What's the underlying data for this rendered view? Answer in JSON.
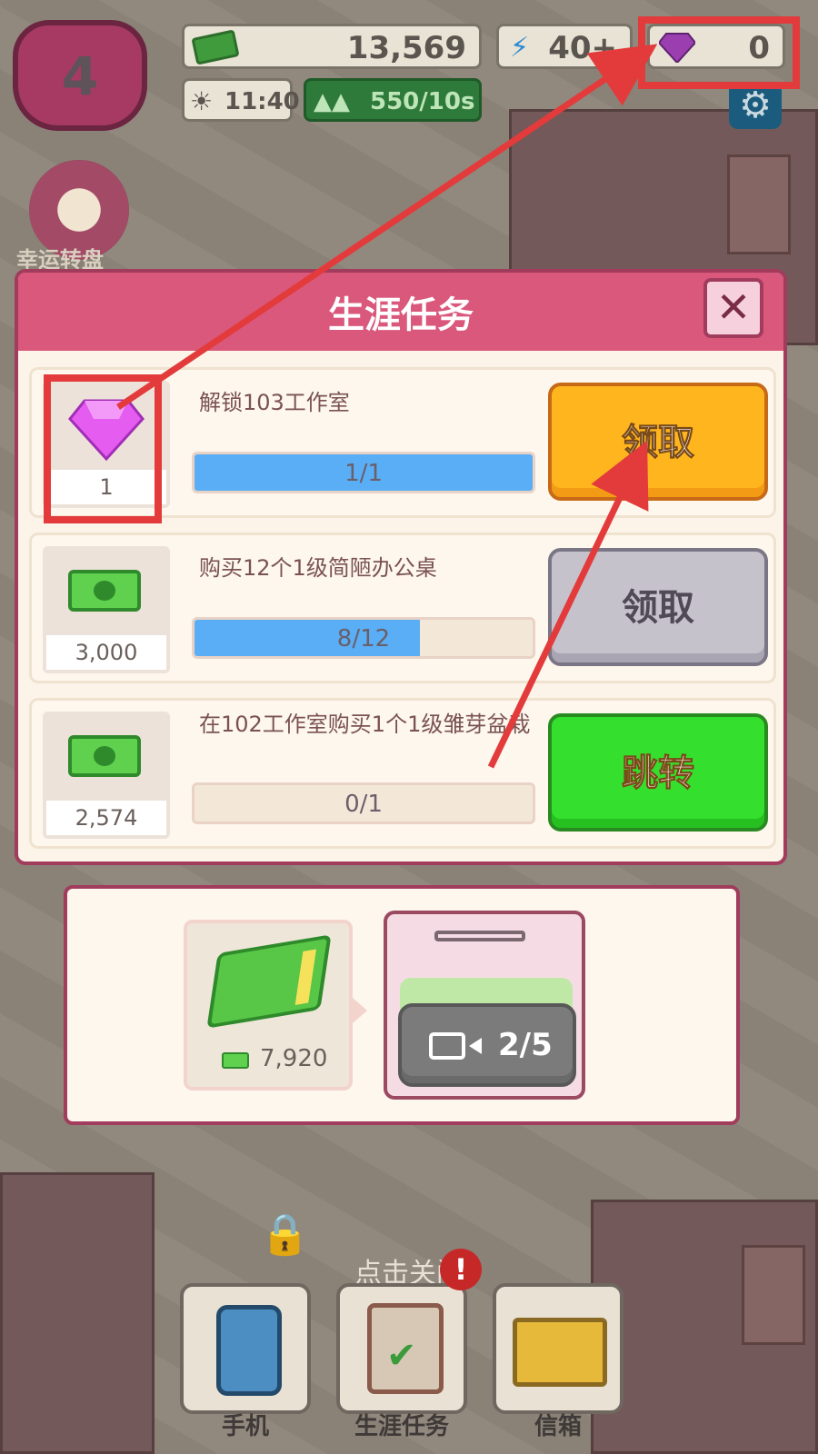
{
  "hud": {
    "level": "4",
    "cash": "13,569",
    "energy": "40+",
    "gems": "0",
    "time": "11:40",
    "income_rate": "550/10s",
    "wheel_label": "幸运转盘"
  },
  "dialog": {
    "title": "生涯任务",
    "close_label": "✕",
    "tasks": [
      {
        "reward_type": "gem",
        "reward_amount": "1",
        "label": "解锁103工作室",
        "progress_text": "1/1",
        "progress_fraction": 1.0,
        "button_label": "领取",
        "button_state": "orange"
      },
      {
        "reward_type": "cash",
        "reward_amount": "3,000",
        "label": "购买12个1级简陋办公桌",
        "progress_text": "8/12",
        "progress_fraction": 0.667,
        "button_label": "领取",
        "button_state": "gray"
      },
      {
        "reward_type": "cash",
        "reward_amount": "2,574",
        "label": "在102工作室购买1个1级雏芽盆栽",
        "progress_text": "0/1",
        "progress_fraction": 0.0,
        "button_label": "跳转",
        "button_state": "green"
      }
    ]
  },
  "bank": {
    "cash_amount": "7,920",
    "video_count": "2/5"
  },
  "close_hint": "点击关闭",
  "dock": {
    "phone_label": "手机",
    "tasks_label": "生涯任务",
    "mail_label": "信箱",
    "alert_mark": "!"
  },
  "colors": {
    "annotation": "#e33b3b",
    "dialog_header": "#d9587c",
    "progress_fill": "#5aaef5"
  }
}
